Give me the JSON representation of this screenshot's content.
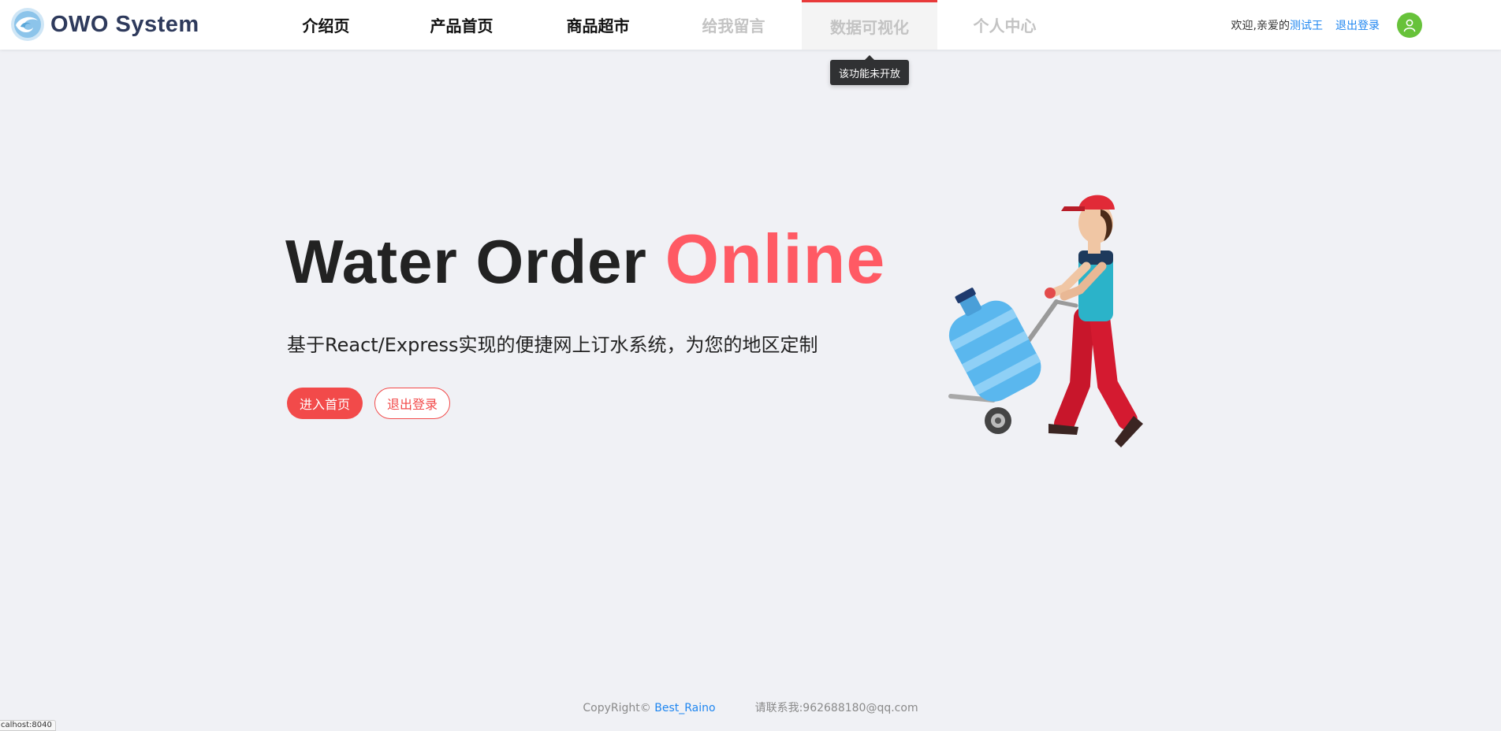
{
  "app": {
    "logo_text": "OWO System"
  },
  "nav": {
    "items": [
      {
        "label": "介绍页"
      },
      {
        "label": "产品首页"
      },
      {
        "label": "商品超市"
      },
      {
        "label": "给我留言"
      },
      {
        "label": "数据可视化"
      },
      {
        "label": "个人中心"
      }
    ],
    "tooltip": "该功能未开放"
  },
  "user": {
    "greeting": "欢迎,亲爱的",
    "name": "测试王",
    "logout": "退出登录"
  },
  "hero": {
    "title_main": "Water Order ",
    "title_accent": "Online",
    "subtitle": "基于React/Express实现的便捷网上订水系统，为您的地区定制",
    "primary_button": "进入首页",
    "secondary_button": "退出登录"
  },
  "footer": {
    "copyright": "CopyRight© ",
    "author": "Best_Raino",
    "contact": "请联系我:962688180@qq.com"
  },
  "status_bar": {
    "url": "calhost:8040"
  },
  "colors": {
    "accent": "#ff5a64",
    "button_red": "#f24a4a",
    "link_blue": "#1f86f0",
    "avatar_green": "#67c23a",
    "page_bg": "#f0f1f5"
  }
}
